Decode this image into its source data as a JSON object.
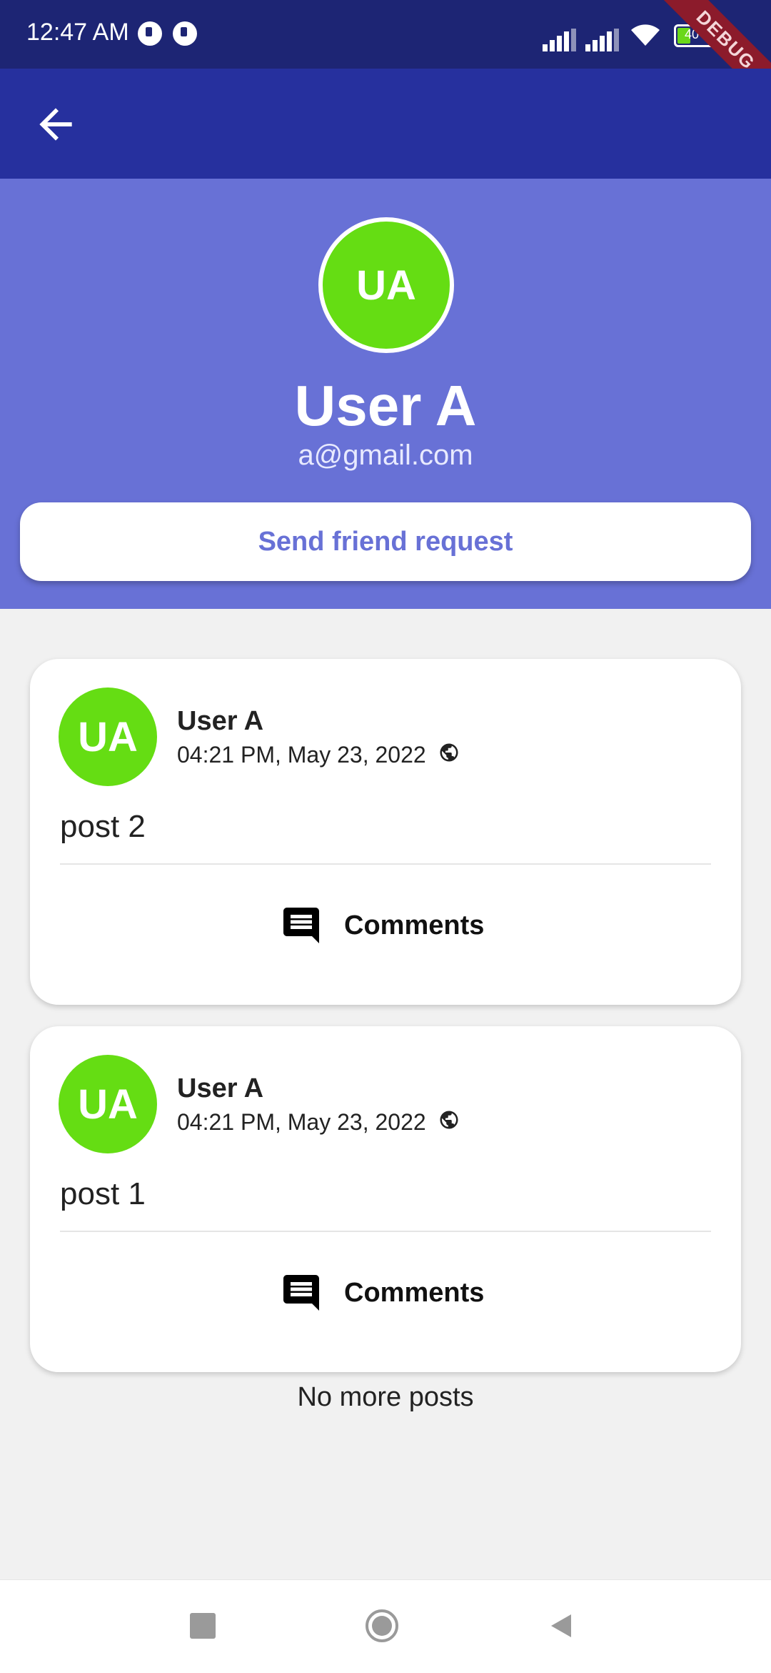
{
  "status_bar": {
    "time": "12:47 AM",
    "battery": "40",
    "debug_banner": "DEBUG"
  },
  "profile": {
    "initials": "UA",
    "name": "User A",
    "email": "a@gmail.com",
    "action_label": "Send friend request"
  },
  "posts": [
    {
      "initials": "UA",
      "author": "User A",
      "time": "04:21 PM, May 23, 2022",
      "body": "post 2",
      "comments_label": "Comments"
    },
    {
      "initials": "UA",
      "author": "User A",
      "time": "04:21 PM, May 23, 2022",
      "body": "post 1",
      "comments_label": "Comments"
    }
  ],
  "footer_text": "No more posts",
  "colors": {
    "status_bar": "#1d2574",
    "app_bar": "#26309e",
    "header": "#6871d6",
    "avatar": "#65dd13",
    "background": "#f1f1f1"
  },
  "icons": {
    "back": "arrow-left-icon",
    "visibility": "globe-icon",
    "comments": "comment-icon"
  }
}
